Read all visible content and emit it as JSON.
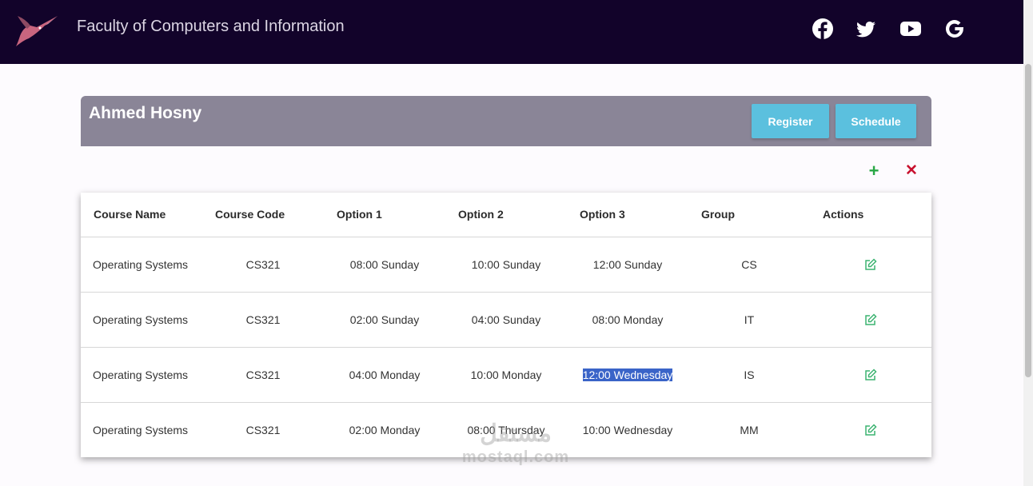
{
  "navbar": {
    "brand": "Faculty of Computers and Information",
    "social": [
      "facebook-icon",
      "twitter-icon",
      "youtube-icon",
      "google-icon"
    ]
  },
  "header": {
    "student_name": "Ahmed Hosny",
    "register_label": "Register",
    "schedule_label": "Schedule"
  },
  "toolbar": {
    "add_icon": "plus-icon",
    "remove_icon": "close-icon"
  },
  "table": {
    "headers": [
      "Course Name",
      "Course Code",
      "Option 1",
      "Option 2",
      "Option 3",
      "Group",
      "Actions"
    ],
    "rows": [
      {
        "course_name": "Operating Systems",
        "course_code": "CS321",
        "option1": "08:00 Sunday",
        "option2": "10:00 Sunday",
        "option3": "12:00 Sunday",
        "group": "CS"
      },
      {
        "course_name": "Operating Systems",
        "course_code": "CS321",
        "option1": "02:00 Sunday",
        "option2": "04:00 Sunday",
        "option3": "08:00 Monday",
        "group": "IT"
      },
      {
        "course_name": "Operating Systems",
        "course_code": "CS321",
        "option1": "04:00 Monday",
        "option2": "10:00 Monday",
        "option3": "12:00 Wednesday",
        "group": "IS"
      },
      {
        "course_name": "Operating Systems",
        "course_code": "CS321",
        "option1": "02:00 Monday",
        "option2": "08:00 Thursday",
        "option3": "10:00 Wednesday",
        "group": "MM"
      }
    ]
  },
  "watermark": {
    "arabic": "مستقل",
    "latin": "mostaql.com"
  },
  "colors": {
    "navbar": "#12032a",
    "header_card": "#8a8597",
    "button": "#5bc0de",
    "add": "#28a745",
    "remove": "#c8102e",
    "edit": "#3cb371",
    "selection": "#3a64c8"
  }
}
